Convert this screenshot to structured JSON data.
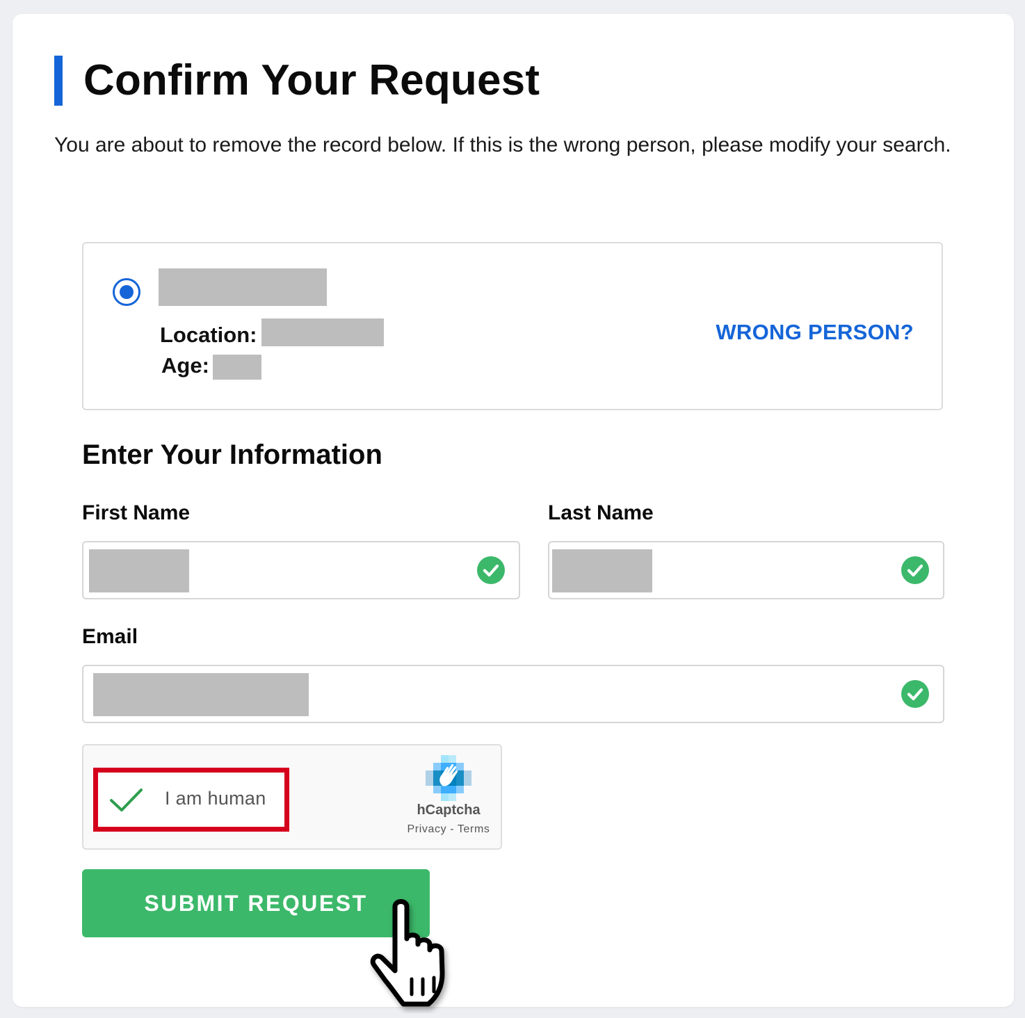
{
  "page": {
    "title": "Confirm Your Request",
    "intro": "You are about to remove the record below. If this is the wrong person, please modify your search."
  },
  "record": {
    "selected": true,
    "location_label": "Location:",
    "age_label": "Age:",
    "wrong_person_link": "WRONG PERSON?",
    "name_redacted": true
  },
  "form": {
    "section_title": "Enter Your Information",
    "first_name": {
      "label": "First Name",
      "valid": true
    },
    "last_name": {
      "label": "Last Name",
      "valid": true
    },
    "email": {
      "label": "Email",
      "valid": true
    }
  },
  "captcha": {
    "checkbox_label": "I am human",
    "checked": true,
    "brand": "hCaptcha",
    "links": "Privacy - Terms"
  },
  "submit": {
    "label": "SUBMIT REQUEST"
  },
  "colors": {
    "accent": "#1565d8",
    "success": "#3cb86a",
    "highlight": "#d5001c"
  }
}
